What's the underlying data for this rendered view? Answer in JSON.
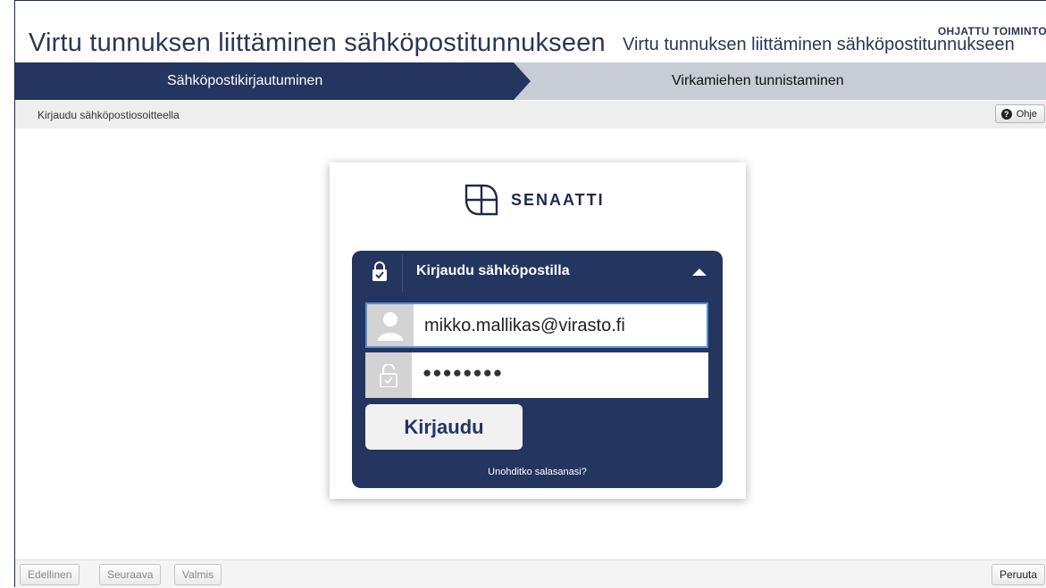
{
  "header": {
    "main_title": "Virtu tunnuksen liittäminen sähköpostitunnukseen",
    "sub_title": "Virtu tunnuksen liittäminen sähköpostitunnukseen",
    "guided_label": "OHJATTU TOIMINTO"
  },
  "steps": [
    {
      "label": "Sähköpostikirjautuminen",
      "active": true
    },
    {
      "label": "Virkamiehen tunnistaminen",
      "active": false
    }
  ],
  "crumb": {
    "text": "Kirjaudu sähköpostiosoitteella"
  },
  "help": {
    "label": "Ohje",
    "icon": "question-icon"
  },
  "login": {
    "logo_text": "SENAATTI",
    "panel_title": "Kirjaudu sähköpostilla",
    "email_value": "mikko.mallikas@virasto.fi",
    "password_masked": "●●●●●●●●",
    "submit_label": "Kirjaudu",
    "forgot_link": "Unohditko salasanasi?"
  },
  "footer": {
    "prev_label": "Edellinen",
    "next_label": "Seuraava",
    "done_label": "Valmis",
    "cancel_label": "Peruuta"
  },
  "colors": {
    "navy": "#24355f",
    "step_inactive": "#c8ccd6",
    "title_text": "#2a3656"
  }
}
